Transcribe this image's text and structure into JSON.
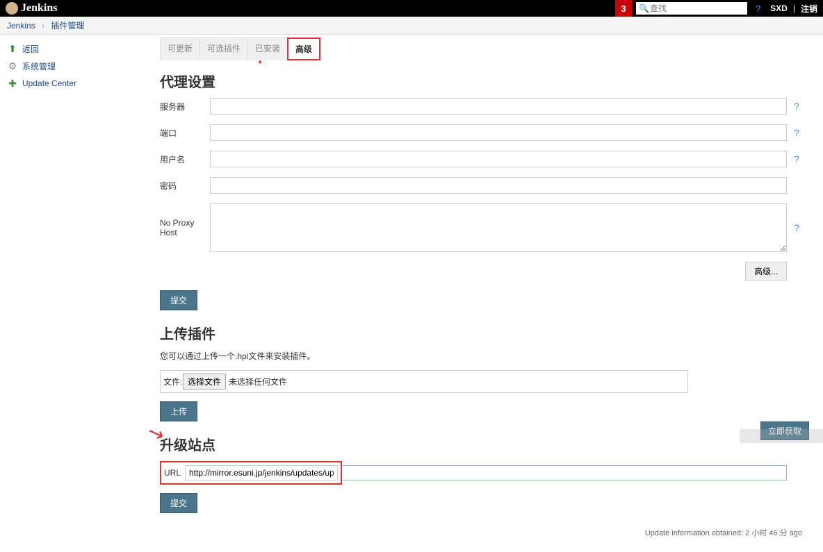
{
  "header": {
    "logo_text": "Jenkins",
    "notification_count": "3",
    "search_placeholder": "查找",
    "user": "SXD",
    "logout": "注销"
  },
  "breadcrumb": {
    "items": [
      "Jenkins",
      "插件管理"
    ]
  },
  "sidebar": {
    "items": [
      {
        "label": "返回",
        "icon": "arrow-up"
      },
      {
        "label": "系统管理",
        "icon": "gear"
      },
      {
        "label": "Update Center",
        "icon": "puzzle"
      }
    ]
  },
  "tabs": {
    "items": [
      "可更新",
      "可选插件",
      "已安装",
      "高级"
    ],
    "active_index": 3
  },
  "proxy_section": {
    "title": "代理设置",
    "server_label": "服务器",
    "port_label": "端口",
    "username_label": "用户名",
    "password_label": "密码",
    "noproxy_label": "No Proxy Host",
    "server_value": "",
    "port_value": "",
    "username_value": "",
    "password_value": "",
    "noproxy_value": "",
    "advanced_btn": "高级...",
    "submit_btn": "提交"
  },
  "upload_section": {
    "title": "上传插件",
    "desc": "您可以通过上传一个.hpi文件来安装插件。",
    "file_label": "文件:",
    "choose_file_btn": "选择文件",
    "no_file_text": "未选择任何文件",
    "upload_btn": "上传"
  },
  "update_site": {
    "title": "升级站点",
    "url_label": "URL",
    "url_value": "http://mirror.esuni.jp/jenkins/updates/update-center.json",
    "submit_btn": "提交"
  },
  "footer": {
    "update_info": "Update information obtained: 2 小时 46 分 ago",
    "fetch_now": "立即获取"
  }
}
